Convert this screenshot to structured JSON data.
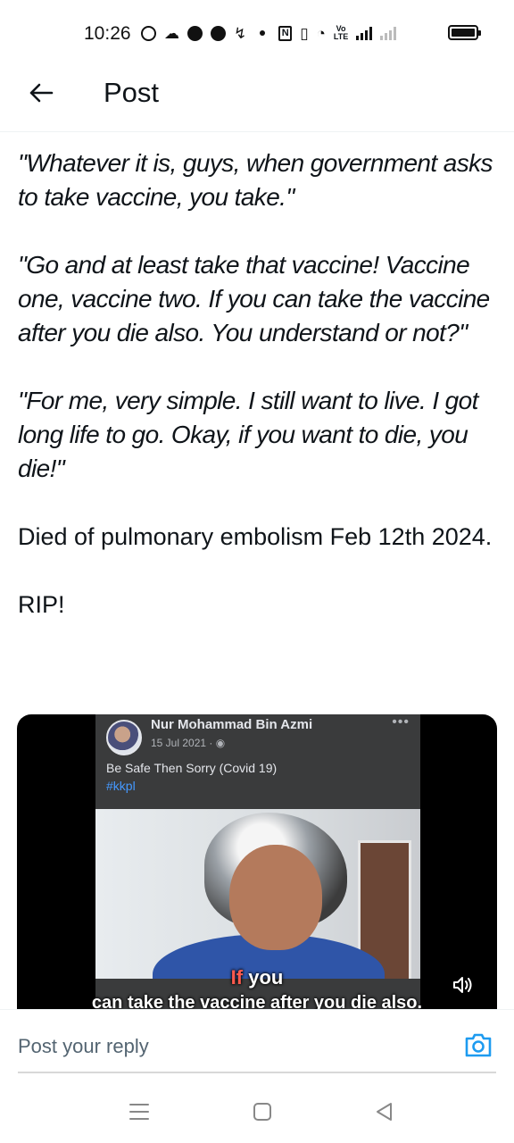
{
  "status_bar": {
    "time": "10:26",
    "icons": [
      "whatsapp-icon",
      "discord-icon",
      "facebook-icon",
      "messenger-icon",
      "missed-call-icon",
      "notification-dot-icon",
      "nfc-icon",
      "vibrate-icon",
      "wifi-icon",
      "volte-icon",
      "signal-icon",
      "signal-2-icon",
      "battery-icon"
    ],
    "volte_label": "Vo\nLTE"
  },
  "header": {
    "back_icon": "arrow-left-icon",
    "title": "Post"
  },
  "post": {
    "paragraphs": [
      {
        "italic": true,
        "text": "\"Whatever it is, guys, when government asks to take vaccine, you take.\""
      },
      {
        "italic": true,
        "text": "\"Go and at least take that vaccine! Vaccine one, vaccine two. If you can take the vaccine after you die also. You understand or not?\""
      },
      {
        "italic": true,
        "text": "\"For me, very simple. I still want to live. I got long life to go. Okay, if you want to die, you die!\""
      },
      {
        "italic": false,
        "text": "Died of pulmonary embolism Feb 12th 2024."
      },
      {
        "italic": false,
        "text": "RIP!"
      }
    ]
  },
  "media": {
    "fb_name": "Nur Mohammad Bin Azmi",
    "fb_date": "15 Jul 2021 · ",
    "fb_dots": "•••",
    "fb_caption": "Be Safe Then Sorry (Covid 19)",
    "fb_hashtag": "#kkpl",
    "subtitle_highlight": "If",
    "subtitle_line1_rest": " you",
    "subtitle_line2": "can take the vaccine after you die also.",
    "mute_icon": "speaker-icon"
  },
  "reply": {
    "placeholder": "Post your reply",
    "camera_icon": "camera-icon"
  },
  "nav": {
    "icons": [
      "menu-icon",
      "home-square-icon",
      "back-triangle-icon"
    ]
  }
}
